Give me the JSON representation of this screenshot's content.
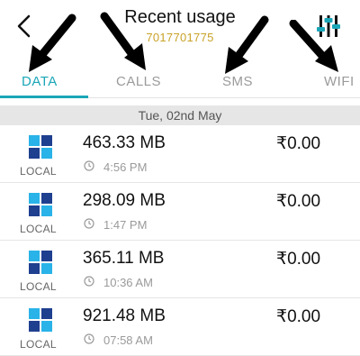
{
  "header": {
    "title": "Recent usage",
    "number": "7017701775"
  },
  "tabs": [
    {
      "label": "DATA",
      "active": true
    },
    {
      "label": "CALLS",
      "active": false
    },
    {
      "label": "SMS",
      "active": false
    },
    {
      "label": "WIFI",
      "active": false
    }
  ],
  "date_header": "Tue, 02nd May",
  "rows": [
    {
      "network": "LOCAL",
      "size": "463.33 MB",
      "time": "4:56 PM",
      "cost": "₹0.00"
    },
    {
      "network": "LOCAL",
      "size": "298.09 MB",
      "time": "1:47 PM",
      "cost": "₹0.00"
    },
    {
      "network": "LOCAL",
      "size": "365.11 MB",
      "time": "10:36 AM",
      "cost": "₹0.00"
    },
    {
      "network": "LOCAL",
      "size": "921.48 MB",
      "time": "07:58 AM",
      "cost": "₹0.00"
    }
  ],
  "colors": {
    "accent": "#1aa6b7",
    "number": "#c9a227",
    "logo_light": "#29b3e8",
    "logo_dark": "#1f3f8f"
  },
  "icons": [
    "back-arrow-icon",
    "filter-sliders-icon",
    "clock-icon",
    "operator-logo-icon"
  ]
}
